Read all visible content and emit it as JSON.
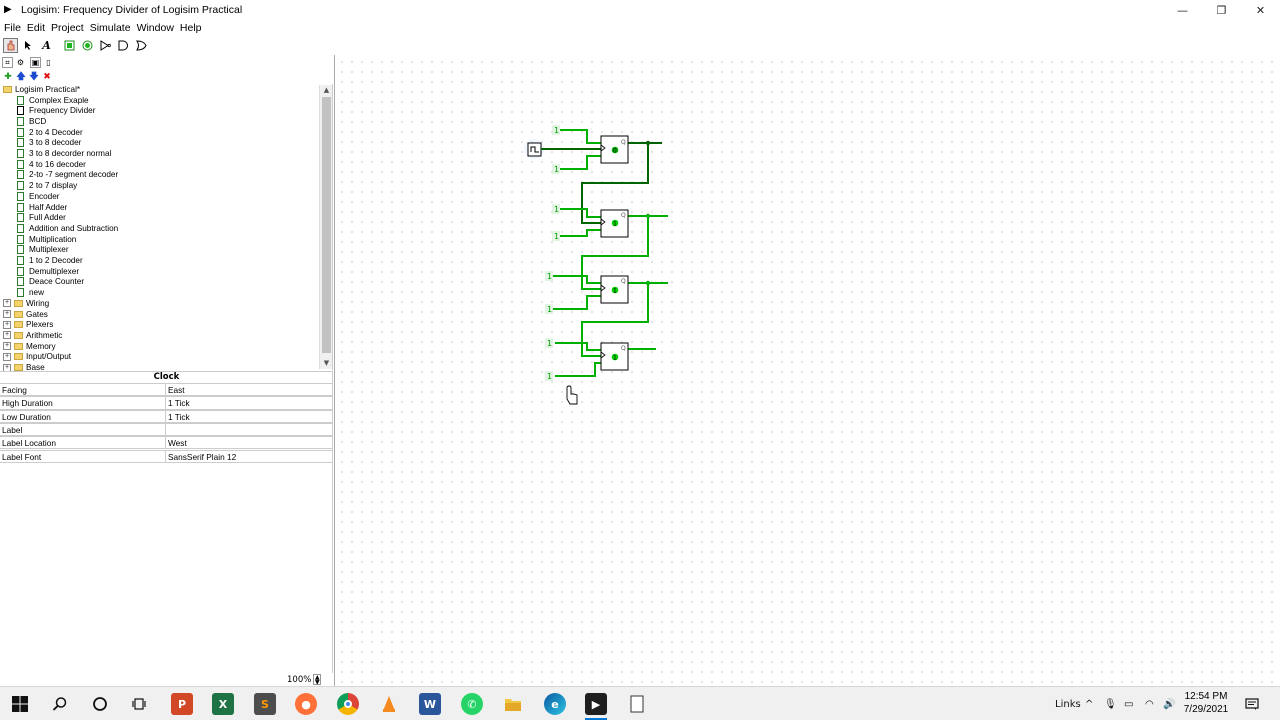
{
  "window": {
    "title": "Logisim: Frequency Divider of Logisim Practical",
    "minimize": "—",
    "maximize": "❐",
    "close": "✕"
  },
  "menu": [
    "File",
    "Edit",
    "Project",
    "Simulate",
    "Window",
    "Help"
  ],
  "explorer": {
    "project": "Logisim Practical*",
    "circuits": [
      "Complex Exaple",
      "Frequency Divider",
      "BCD",
      "2 to 4 Decoder",
      "3 to 8  decoder",
      "3 to 8 decorder normal",
      "4 to 16 decoder",
      "2-to -7 segment decoder",
      "2 to 7 display",
      "Encoder",
      "Half Adder",
      "Full Adder",
      "Addition and Subtraction",
      "Multiplication",
      "Multiplexer",
      "1 to 2 Decoder",
      "Demultiplexer",
      "Deace Counter",
      "new"
    ],
    "libraries": [
      "Wiring",
      "Gates",
      "Plexers",
      "Arithmetic",
      "Memory",
      "Input/Output",
      "Base"
    ]
  },
  "attributes": {
    "title": "Clock",
    "rows": [
      {
        "key": "Facing",
        "value": "East"
      },
      {
        "key": "High Duration",
        "value": "1 Tick"
      },
      {
        "key": "Low Duration",
        "value": "1 Tick"
      },
      {
        "key": "Label",
        "value": ""
      },
      {
        "key": "Label Location",
        "value": "West"
      },
      {
        "key": "Label Font",
        "value": "SansSerif Plain 12"
      }
    ]
  },
  "zoom": "100%",
  "circuit": {
    "constant_label": "1",
    "flipflop_label": "Q",
    "flipflop_states": [
      "0",
      "1",
      "1",
      "1"
    ]
  },
  "taskbar": {
    "links": "Links",
    "time": "12:54 PM",
    "date": "7/29/2021"
  }
}
